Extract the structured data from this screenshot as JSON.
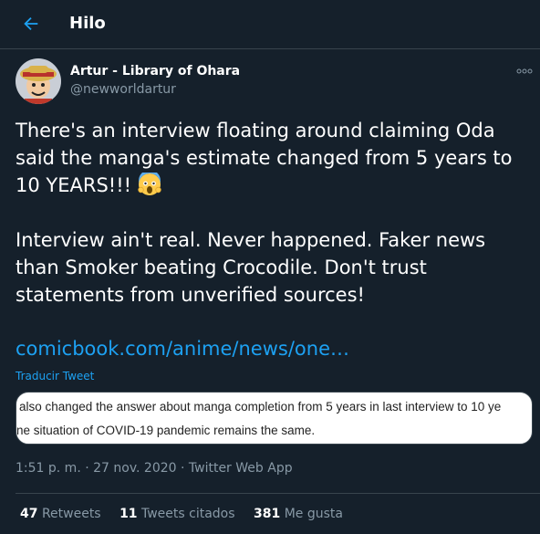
{
  "header": {
    "title": "Hilo",
    "back_icon": "arrow-left-icon"
  },
  "author": {
    "name": "Artur - Library of Ohara",
    "handle": "@newworldartur",
    "avatar_icon": "avatar-icon"
  },
  "tweet": {
    "text_p1": "There's an interview floating around claiming Oda said the manga's estimate changed from 5 years to 10 YEARS!!! ",
    "emoji": "face-screaming-in-fear-emoji",
    "text_p2": "Interview ain't real. Never happened. Faker news than Smoker beating Crocodile. Don't trust statements from unverified sources!",
    "link": "comicbook.com/anime/news/one…",
    "translate": "Traducir Tweet",
    "image_lines": [
      "also changed the answer about manga completion from 5 years in last interview to 10 ye",
      "ne situation of COVID-19 pandemic remains the same."
    ],
    "meta": "1:51 p. m. · 27 nov. 2020 · Twitter Web App"
  },
  "stats": {
    "retweets_count": "47",
    "retweets_label": "Retweets",
    "quotes_count": "11",
    "quotes_label": "Tweets citados",
    "likes_count": "381",
    "likes_label": "Me gusta"
  },
  "colors": {
    "background": "#15202b",
    "accent": "#1da1f2",
    "secondary_text": "#8899a6",
    "border": "#38444d"
  }
}
